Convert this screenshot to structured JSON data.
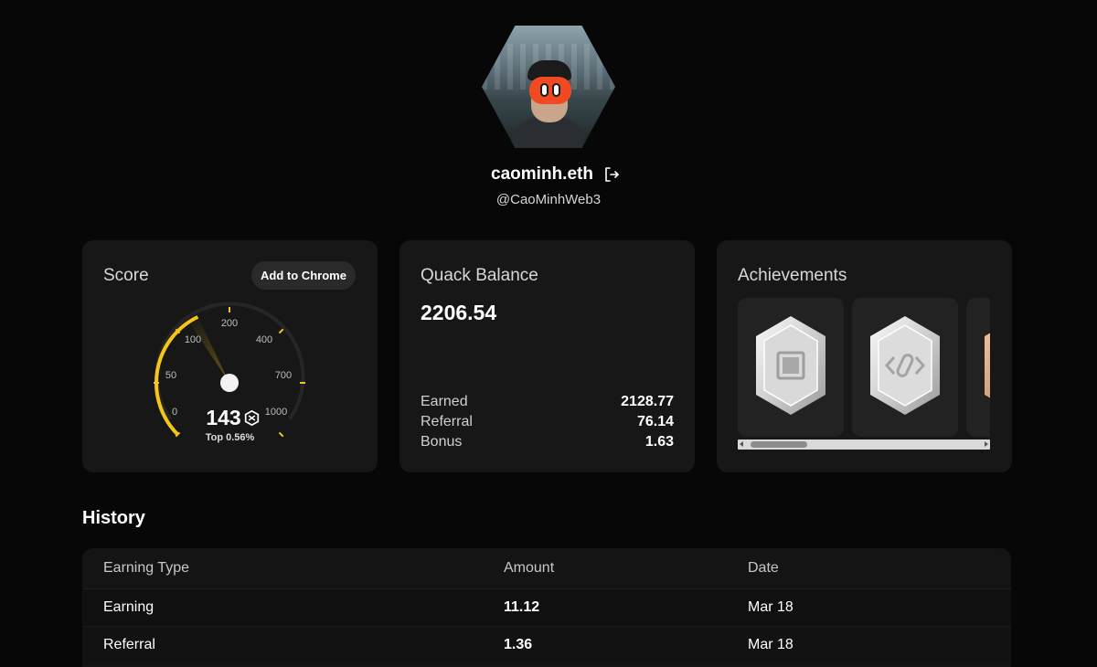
{
  "profile": {
    "ens_name": "caominh.eth",
    "handle": "@CaoMinhWeb3"
  },
  "score_card": {
    "title": "Score",
    "add_to_chrome_label": "Add to Chrome",
    "gauge_ticks": [
      "0",
      "50",
      "100",
      "200",
      "400",
      "700",
      "1000"
    ],
    "score": "143",
    "rank": "Top 0.56%",
    "accent_color": "#f5c518"
  },
  "balance_card": {
    "title": "Quack Balance",
    "balance": "2206.54",
    "rows": [
      {
        "label": "Earned",
        "value": "2128.77"
      },
      {
        "label": "Referral",
        "value": "76.14"
      },
      {
        "label": "Bonus",
        "value": "1.63"
      }
    ]
  },
  "achievements_card": {
    "title": "Achievements",
    "badges": [
      {
        "icon": "square-stack-badge-icon"
      },
      {
        "icon": "code-link-badge-icon"
      },
      {
        "icon": "bronze-badge-icon"
      }
    ]
  },
  "history": {
    "title": "History",
    "columns": [
      "Earning Type",
      "Amount",
      "Date"
    ],
    "rows": [
      {
        "type": "Earning",
        "amount": "11.12",
        "date": "Mar 18"
      },
      {
        "type": "Referral",
        "amount": "1.36",
        "date": "Mar 18"
      }
    ]
  }
}
